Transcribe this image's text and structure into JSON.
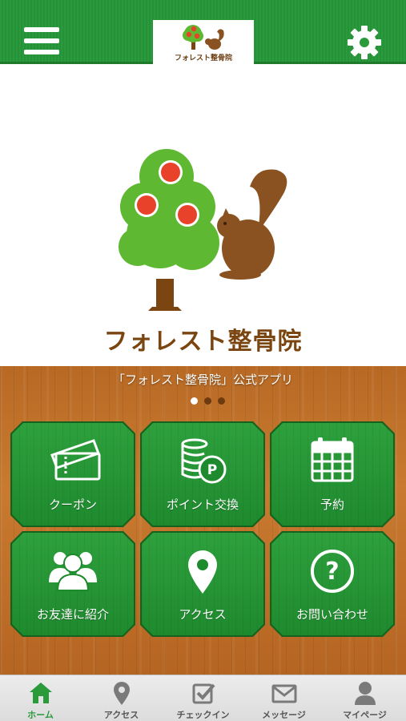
{
  "header": {
    "logo_text": "フォレスト整骨院"
  },
  "hero": {
    "clinic_name": "フォレスト整骨院"
  },
  "carousel": {
    "caption": "「フォレスト整骨院」公式アプリ",
    "page_count": 3,
    "active_page": 1
  },
  "menu": {
    "coupon": "クーポン",
    "points": "ポイント交換",
    "reserve": "予約",
    "invite": "お友達に紹介",
    "access": "アクセス",
    "contact": "お問い合わせ"
  },
  "tabs": {
    "home": "ホーム",
    "access": "アクセス",
    "checkin": "チェックイン",
    "message": "メッセージ",
    "mypage": "マイページ"
  },
  "colors": {
    "brand_green": "#2a9a3a",
    "wood_brown": "#c97a30",
    "logo_brown": "#7a4510",
    "apple_red": "#e8432a"
  },
  "icons": {
    "menu": "hamburger-icon",
    "settings": "gear-icon"
  }
}
